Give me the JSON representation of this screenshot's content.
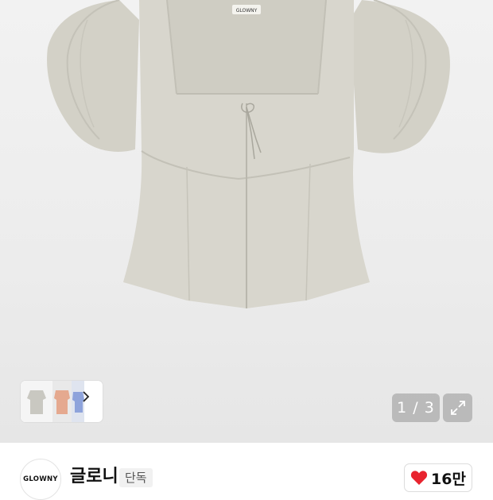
{
  "gallery": {
    "counter": "1 / 3",
    "product_image_label": "GLOWNY",
    "thumbnails": [
      "thumbnail-gray-top",
      "thumbnail-pink-top",
      "thumbnail-blue-top"
    ]
  },
  "brand": {
    "logo_text": "GLOWNY",
    "name": "글로니",
    "tag": "단독"
  },
  "like": {
    "count": "16만",
    "icon": "heart-icon",
    "color": "#e8242f"
  },
  "colors": {
    "garment": "#d8d6cd",
    "accent_heart": "#e8242f"
  }
}
